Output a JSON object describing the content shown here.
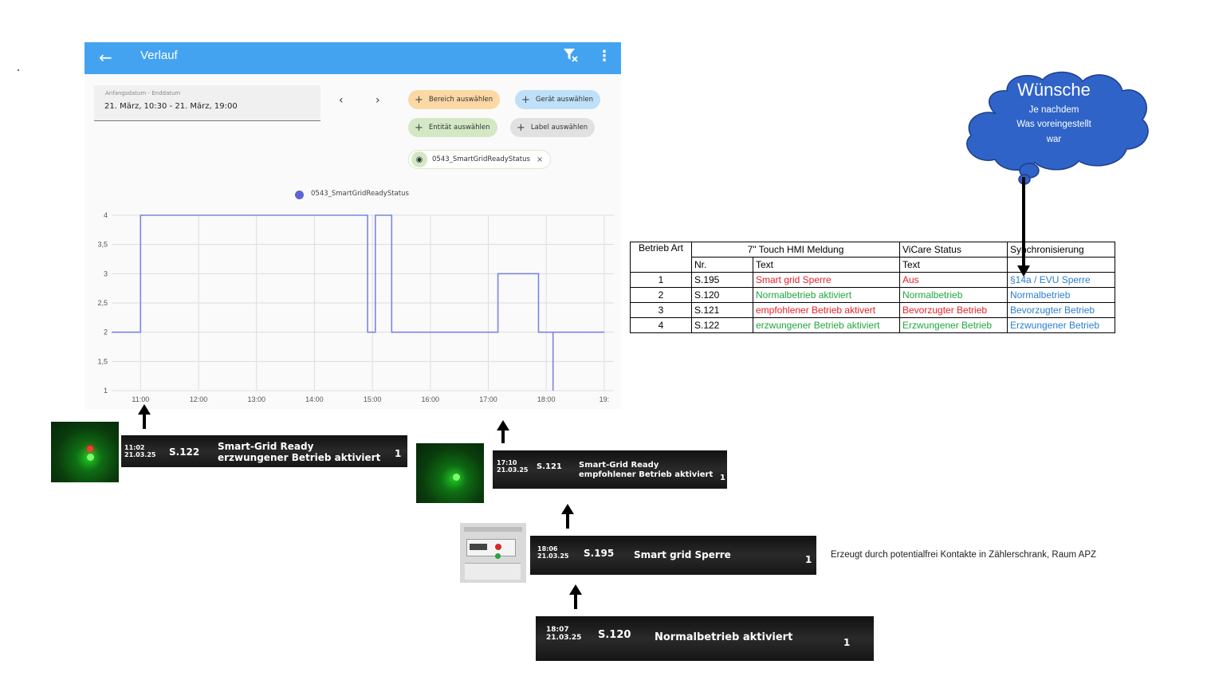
{
  "app": {
    "title": "Verlauf",
    "back_icon": "←",
    "filter_icon": "⛉",
    "menu_icon": "⋮",
    "date_label": "Anfangsdatum - Enddatum",
    "date_value": "21. März, 10:30 - 21. März, 19:00",
    "prev": "‹",
    "next": "›",
    "chips": {
      "bereich": "Bereich auswählen",
      "geraet": "Gerät auswählen",
      "entitaet": "Entität auswählen",
      "label": "Label auswählen",
      "entity": "0543_SmartGridReadyStatus",
      "plus": "+",
      "eye": "◉",
      "close": "×"
    },
    "legend": "0543_SmartGridReadyStatus"
  },
  "chart_data": {
    "type": "line",
    "series": [
      {
        "name": "0543_SmartGridReadyStatus",
        "color": "#7a86e0",
        "x": [
          "10:30",
          "11:00",
          "11:00",
          "14:55",
          "14:55",
          "15:03",
          "15:03",
          "15:20",
          "15:20",
          "17:10",
          "17:10",
          "17:52",
          "17:52",
          "18:07",
          "18:07",
          "18:07",
          "19:00"
        ],
        "y": [
          2,
          2,
          4,
          4,
          2,
          2,
          4,
          4,
          2,
          2,
          3,
          3,
          2,
          2,
          1,
          2,
          2
        ]
      }
    ],
    "x_ticks": [
      "11:00",
      "12:00",
      "13:00",
      "14:00",
      "15:00",
      "16:00",
      "17:00",
      "18:00",
      "19:"
    ],
    "y_ticks": [
      "4",
      "3,5",
      "3",
      "2,5",
      "2",
      "1,5",
      "1"
    ],
    "ylim": [
      1,
      4
    ],
    "xlim": [
      "10:30",
      "19:10"
    ],
    "grid": true,
    "legend_position": "top-center"
  },
  "cloud": {
    "title": "Wünsche",
    "line1": "Je nachdem",
    "line2": "Was voreingestellt",
    "line3": "war",
    "color": "#2f63c8"
  },
  "table": {
    "header1": [
      "Betrieb Art",
      "7\" Touch HMI Meldung",
      "ViCare Status",
      "Synchronisierung"
    ],
    "header2": [
      "Nr.",
      "Text",
      "Text"
    ],
    "rows": [
      {
        "art": "1",
        "nr": "S.195",
        "text": "Smart grid Sperre",
        "vicare": "Aus",
        "sync": "§14a / EVU Sperre",
        "text_color": "red",
        "vicare_color": "red"
      },
      {
        "art": "2",
        "nr": "S.120",
        "text": "Normalbetrieb aktiviert",
        "vicare": "Normalbetrieb",
        "sync": "Normalbetrieb",
        "text_color": "green",
        "vicare_color": "green"
      },
      {
        "art": "3",
        "nr": "S.121",
        "text": "empfohlener Betrieb aktivert",
        "vicare": "Bevorzugter Betrieb",
        "sync": "Bevorzugter Betrieb",
        "text_color": "red",
        "vicare_color": "red"
      },
      {
        "art": "4",
        "nr": "S.122",
        "text": "erzwungener Betrieb aktiviert",
        "vicare": "Erzwungener Betrieb",
        "sync": "Erzwungener Betrieb",
        "text_color": "green",
        "vicare_color": "green"
      }
    ]
  },
  "hmi_messages": [
    {
      "time": "11:02",
      "date": "21.03.25",
      "code": "S.122",
      "line1": "Smart-Grid Ready",
      "line2": "erzwungener Betrieb aktiviert",
      "count": "1"
    },
    {
      "time": "17:10",
      "date": "21.03.25",
      "code": "S.121",
      "line1": "Smart-Grid Ready",
      "line2": "empfohlener Betrieb aktiviert",
      "count": "1"
    },
    {
      "time": "18:06",
      "date": "21.03.25",
      "code": "S.195",
      "line1": "Smart grid Sperre",
      "line2": "",
      "count": "1"
    },
    {
      "time": "18:07",
      "date": "21.03.25",
      "code": "S.120",
      "line1": "Normalbetrieb aktiviert",
      "line2": "",
      "count": "1"
    }
  ],
  "note": "Erzeugt durch potentialfrei Kontakte in Zählerschrank, Raum APZ"
}
